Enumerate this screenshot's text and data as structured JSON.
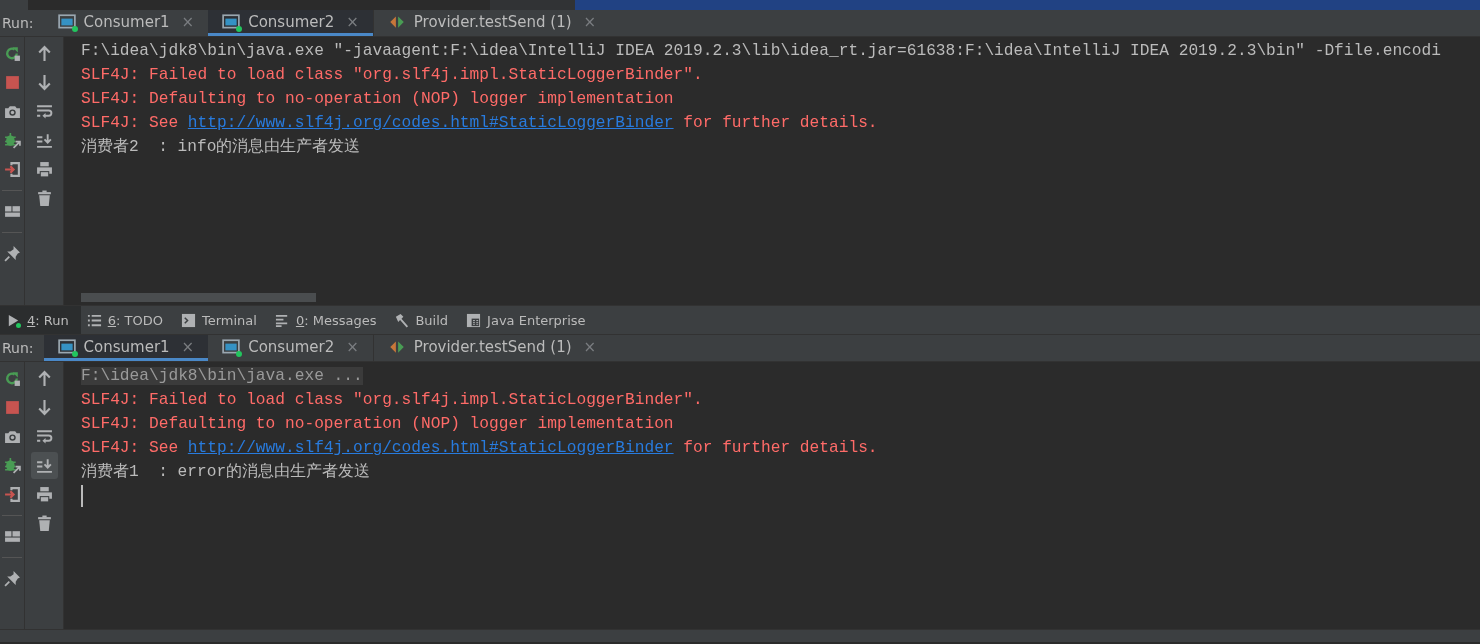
{
  "run_panels": [
    {
      "run_label": "Run:",
      "autoscroll_on": false,
      "has_hscroll": true,
      "tabs": [
        {
          "label": "Consumer1",
          "close": "×",
          "selected": false,
          "kind": "app",
          "running": true
        },
        {
          "label": "Consumer2",
          "close": "×",
          "selected": true,
          "kind": "app",
          "running": true
        },
        {
          "label": "Provider.testSend (1)",
          "close": "×",
          "selected": false,
          "kind": "test",
          "running": false
        }
      ],
      "lines": [
        {
          "kind": "command",
          "segments": [
            {
              "text": "F:\\idea\\jdk8\\bin\\java.exe \"-javaagent:F:\\idea\\IntelliJ IDEA 2019.2.3\\lib\\idea_rt.jar=61638:F:\\idea\\IntelliJ IDEA 2019.2.3\\bin\" -Dfile.encodi",
              "link": false
            }
          ]
        },
        {
          "kind": "error",
          "segments": [
            {
              "text": "SLF4J: Failed to load class \"org.slf4j.impl.StaticLoggerBinder\".",
              "link": false
            }
          ]
        },
        {
          "kind": "error",
          "segments": [
            {
              "text": "SLF4J: Defaulting to no-operation (NOP) logger implementation",
              "link": false
            }
          ]
        },
        {
          "kind": "error",
          "segments": [
            {
              "text": "SLF4J: See ",
              "link": false
            },
            {
              "text": "http://www.slf4j.org/codes.html#StaticLoggerBinder",
              "link": true
            },
            {
              "text": " for further details.",
              "link": false
            }
          ]
        },
        {
          "kind": "output",
          "segments": [
            {
              "text": "消费者2  : info的消息由生产者发送",
              "link": false
            }
          ]
        }
      ]
    },
    {
      "run_label": "Run:",
      "autoscroll_on": true,
      "has_hscroll": false,
      "tabs": [
        {
          "label": "Consumer1",
          "close": "×",
          "selected": true,
          "kind": "app",
          "running": true
        },
        {
          "label": "Consumer2",
          "close": "×",
          "selected": false,
          "kind": "app",
          "running": true
        },
        {
          "label": "Provider.testSend (1)",
          "close": "×",
          "selected": false,
          "kind": "test",
          "running": false
        }
      ],
      "lines": [
        {
          "kind": "folded",
          "segments": [
            {
              "text": "F:\\idea\\jdk8\\bin\\java.exe ...",
              "link": false
            }
          ]
        },
        {
          "kind": "error",
          "segments": [
            {
              "text": "SLF4J: Failed to load class \"org.slf4j.impl.StaticLoggerBinder\".",
              "link": false
            }
          ]
        },
        {
          "kind": "error",
          "segments": [
            {
              "text": "SLF4J: Defaulting to no-operation (NOP) logger implementation",
              "link": false
            }
          ]
        },
        {
          "kind": "error",
          "segments": [
            {
              "text": "SLF4J: See ",
              "link": false
            },
            {
              "text": "http://www.slf4j.org/codes.html#StaticLoggerBinder",
              "link": true
            },
            {
              "text": " for further details.",
              "link": false
            }
          ]
        },
        {
          "kind": "output",
          "segments": [
            {
              "text": "消费者1  : error的消息由生产者发送",
              "link": false
            }
          ]
        },
        {
          "kind": "cursor"
        }
      ]
    }
  ],
  "tool_windows": [
    {
      "kind": "run",
      "mnemonic": "4",
      "label": ": Run",
      "selected": true
    },
    {
      "kind": "todo",
      "mnemonic": "6",
      "label": ": TODO",
      "selected": false
    },
    {
      "kind": "terminal",
      "label": "Terminal",
      "selected": false
    },
    {
      "kind": "messages",
      "mnemonic": "0",
      "label": ": Messages",
      "selected": false
    },
    {
      "kind": "build",
      "label": "Build",
      "selected": false
    },
    {
      "kind": "javaee",
      "label": "Java Enterprise",
      "selected": false
    }
  ]
}
